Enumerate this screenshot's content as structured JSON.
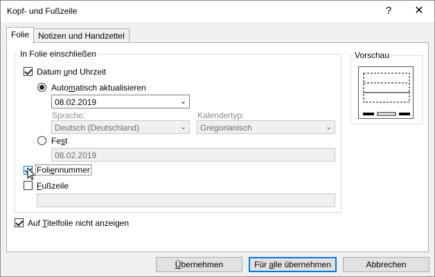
{
  "window": {
    "title": "Kopf- und Fußzeile",
    "help_glyph": "?",
    "close_glyph": "✕"
  },
  "tabs": [
    {
      "label": "Folie",
      "active": true
    },
    {
      "label": "Notizen und Handzettel",
      "active": false
    }
  ],
  "include_group": {
    "label": "In Folie einschließen",
    "date_time": {
      "label_pre": "Datum ",
      "label_u": "u",
      "label_post": "nd Uhrzeit",
      "checked": true
    },
    "auto_update": {
      "label_pre": "Auto",
      "label_u": "m",
      "label_post": "atisch aktualisieren",
      "selected": true,
      "date_value": "08.02.2019"
    },
    "language": {
      "label": "Sprache:",
      "value": "Deutsch (Deutschland)"
    },
    "calendar": {
      "label": "Kalendertyp:",
      "value": "Gregorianisch"
    },
    "fixed": {
      "label_pre": "Fe",
      "label_u": "s",
      "label_post": "t",
      "selected": false,
      "value": "08.02.2019"
    },
    "slide_number": {
      "label_pre": "Foli",
      "label_u": "e",
      "label_post": "nnummer",
      "checked": true
    },
    "footer": {
      "label_pre": "",
      "label_u": "F",
      "label_post": "ußzeile",
      "checked": false,
      "value": ""
    }
  },
  "title_slide": {
    "label_pre": "Auf ",
    "label_u": "T",
    "label_post": "itelfolie nicht anzeigen",
    "checked": true
  },
  "preview": {
    "label": "Vorschau"
  },
  "buttons": {
    "apply": {
      "pre": "",
      "u": "Ü",
      "post": "bernehmen"
    },
    "apply_all": {
      "pre": "Für ",
      "u": "a",
      "post": "lle übernehmen"
    },
    "cancel": {
      "label": "Abbrechen"
    }
  },
  "icons": {
    "dropdown": "chevron-down-icon",
    "cursor": "arrow-cursor-icon"
  },
  "colors": {
    "accent": "#0078d7",
    "dialog_bg": "#f0f0f0"
  }
}
